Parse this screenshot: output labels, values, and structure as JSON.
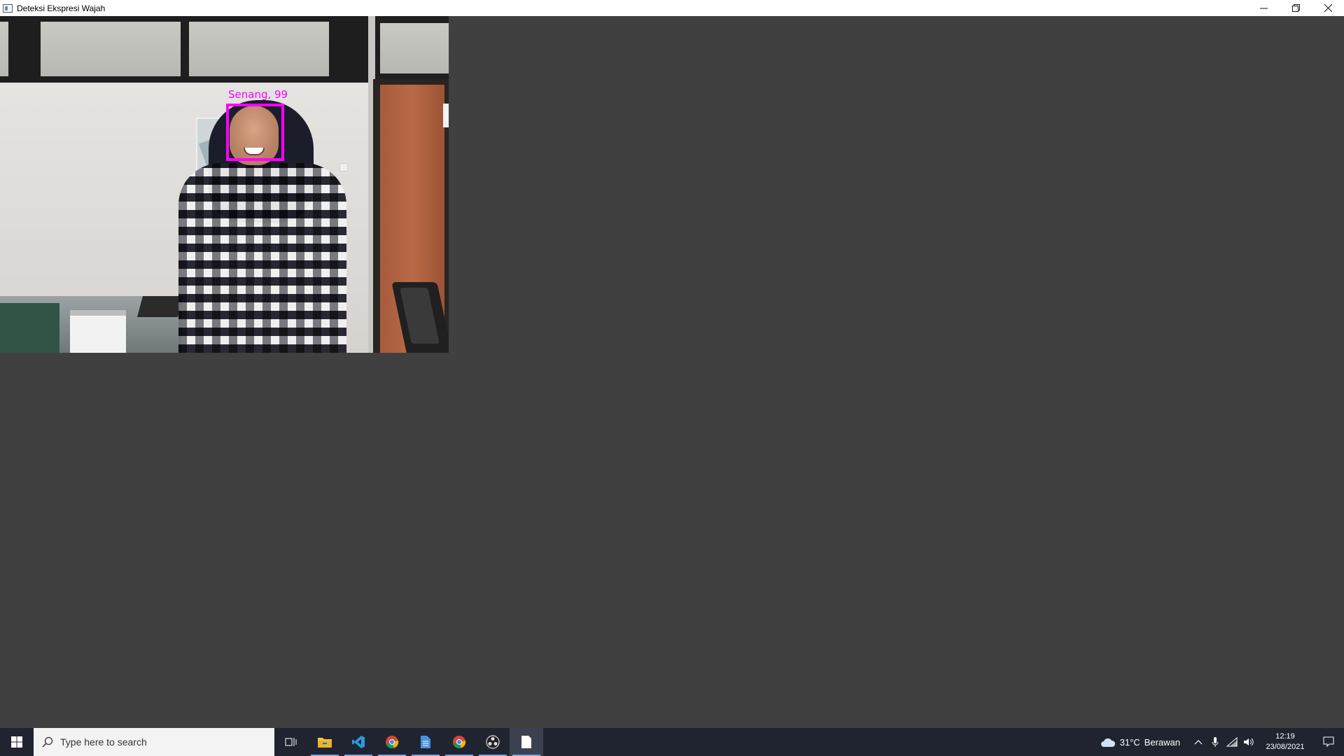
{
  "window": {
    "title": "Deteksi Ekspresi Wajah"
  },
  "detection": {
    "label": "Senang, 99",
    "box_color": "#ff00ff"
  },
  "taskbar": {
    "search_placeholder": "Type here to search",
    "apps": [
      {
        "name": "task-view",
        "icon": "task-view-icon"
      },
      {
        "name": "file-explorer",
        "icon": "folder-icon"
      },
      {
        "name": "vscode",
        "icon": "vscode-icon"
      },
      {
        "name": "chrome-profile-1",
        "icon": "chrome-icon"
      },
      {
        "name": "notepad-file",
        "icon": "document-icon"
      },
      {
        "name": "chrome-profile-2",
        "icon": "chrome-icon"
      },
      {
        "name": "obs",
        "icon": "obs-icon"
      },
      {
        "name": "face-app",
        "icon": "window-icon"
      }
    ],
    "weather": {
      "temp": "31°C",
      "condition": "Berawan"
    },
    "clock": {
      "time": "12:19",
      "date": "23/08/2021"
    }
  },
  "colors": {
    "background": "#404040",
    "taskbar": "#1f2430",
    "accent": "#ff00ff"
  }
}
